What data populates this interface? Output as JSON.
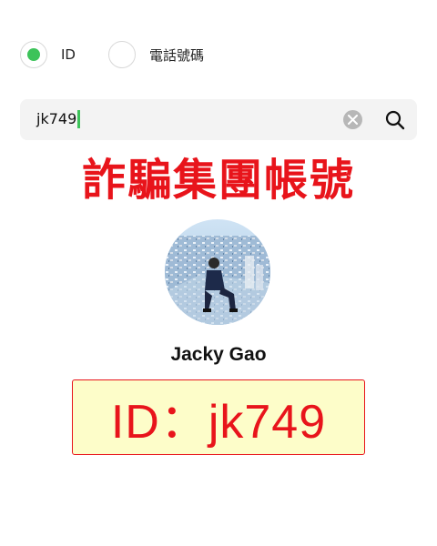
{
  "search_type": {
    "options": [
      {
        "label": "ID",
        "selected": true
      },
      {
        "label": "電話號碼",
        "selected": false
      }
    ],
    "accent_color": "#3dc35a"
  },
  "search": {
    "value": "jk749",
    "clear_icon": "clear-circle-icon",
    "search_icon": "magnifier-icon"
  },
  "warning_banner": {
    "text": "詐騙集團帳號",
    "color": "#e8141b"
  },
  "profile": {
    "name": "Jacky Gao",
    "avatar": "profile-photo"
  },
  "id_callout": {
    "text": "ID：jk749",
    "text_color": "#e8141b",
    "background": "#fdfdc9"
  }
}
